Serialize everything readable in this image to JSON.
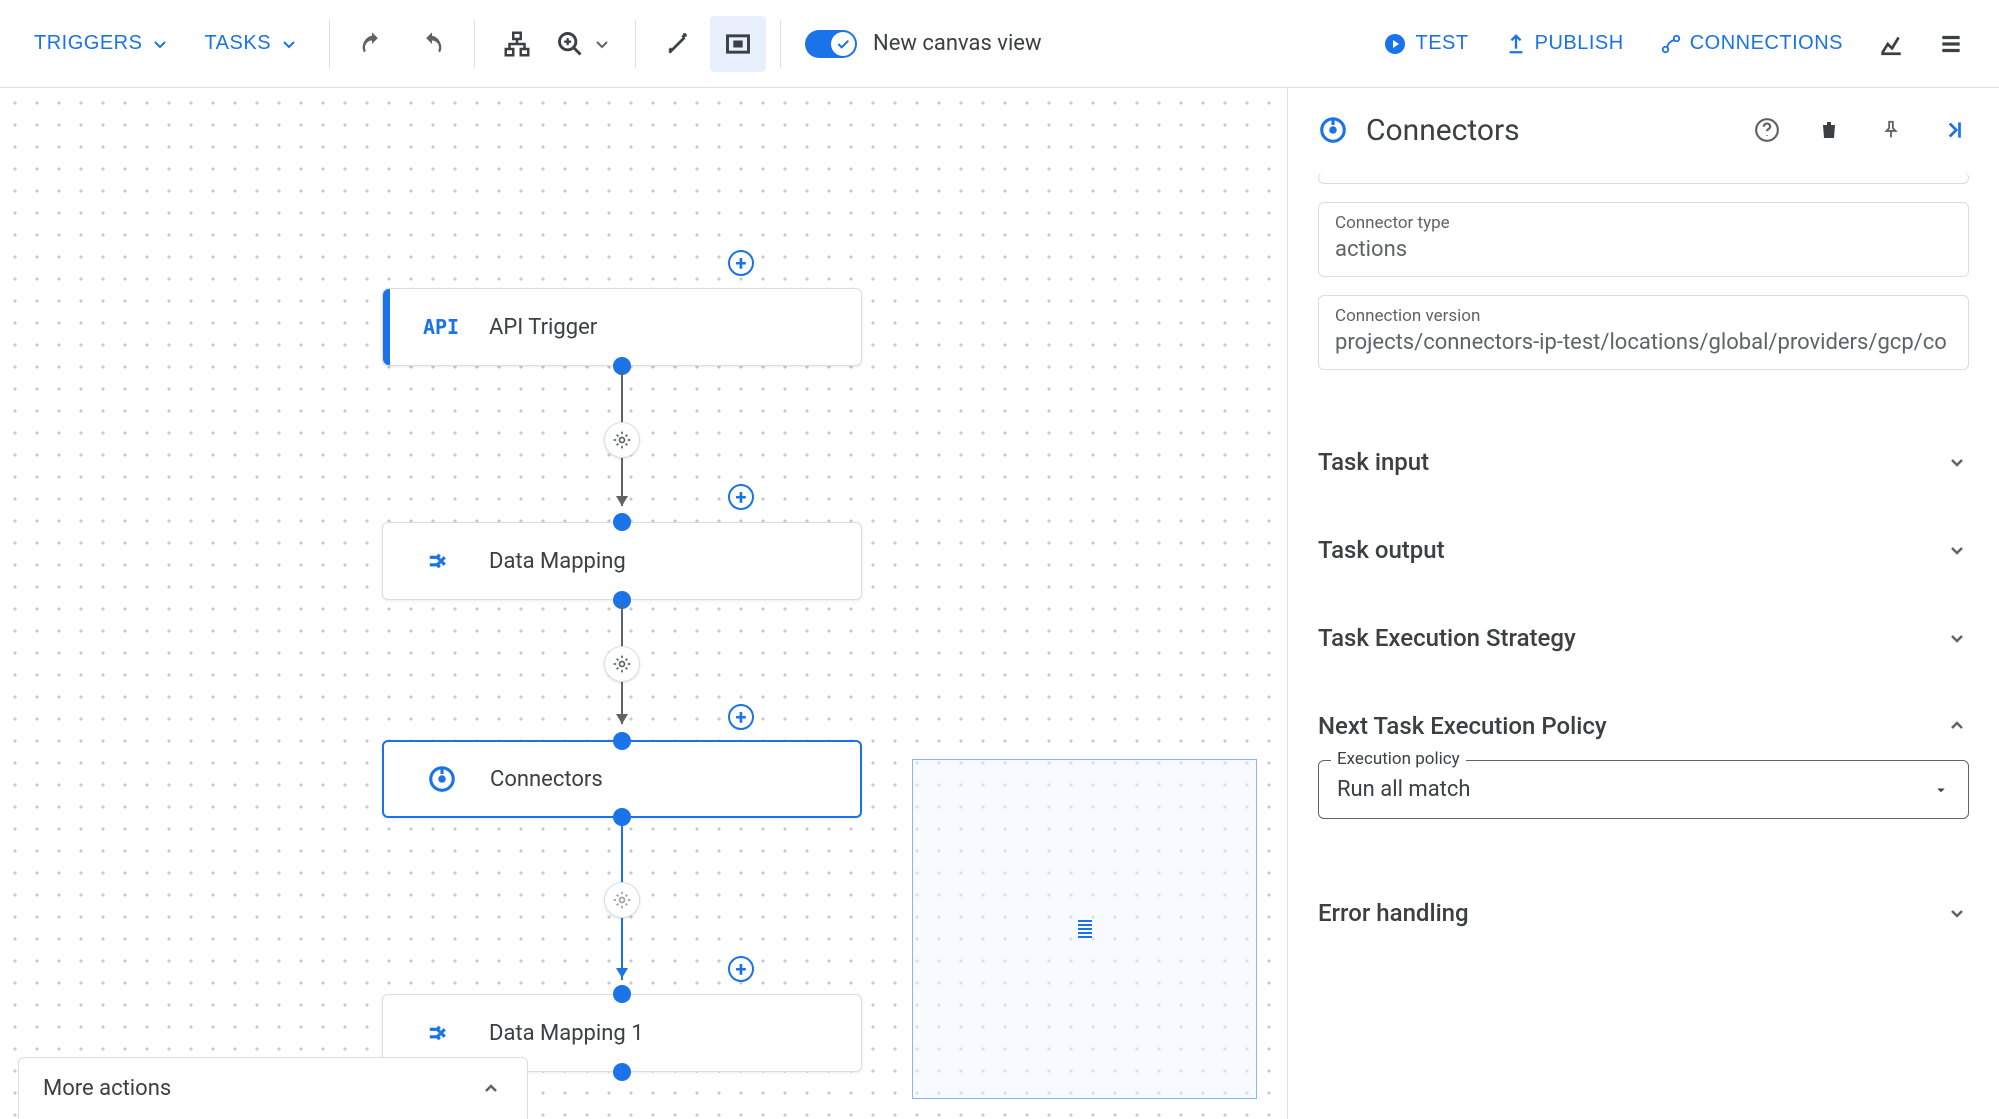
{
  "toolbar": {
    "triggers": "TRIGGERS",
    "tasks": "TASKS",
    "canvas_view_label": "New canvas view",
    "test": "TEST",
    "publish": "PUBLISH",
    "connections": "CONNECTIONS"
  },
  "nodes": [
    {
      "icon": "API",
      "label": "API Trigger"
    },
    {
      "icon": "mapping",
      "label": "Data Mapping"
    },
    {
      "icon": "connector",
      "label": "Connectors"
    },
    {
      "icon": "mapping",
      "label": "Data Mapping 1"
    }
  ],
  "more_actions": "More actions",
  "panel": {
    "title": "Connectors",
    "connector_type_label": "Connector type",
    "connector_type_value": "actions",
    "connection_version_label": "Connection version",
    "connection_version_value": "projects/connectors-ip-test/locations/global/providers/gcp/co",
    "sections": {
      "task_input": "Task input",
      "task_output": "Task output",
      "task_exec_strategy": "Task Execution Strategy",
      "next_task_policy": "Next Task Execution Policy",
      "error_handling": "Error handling"
    },
    "execution_policy_label": "Execution policy",
    "execution_policy_value": "Run all match"
  }
}
